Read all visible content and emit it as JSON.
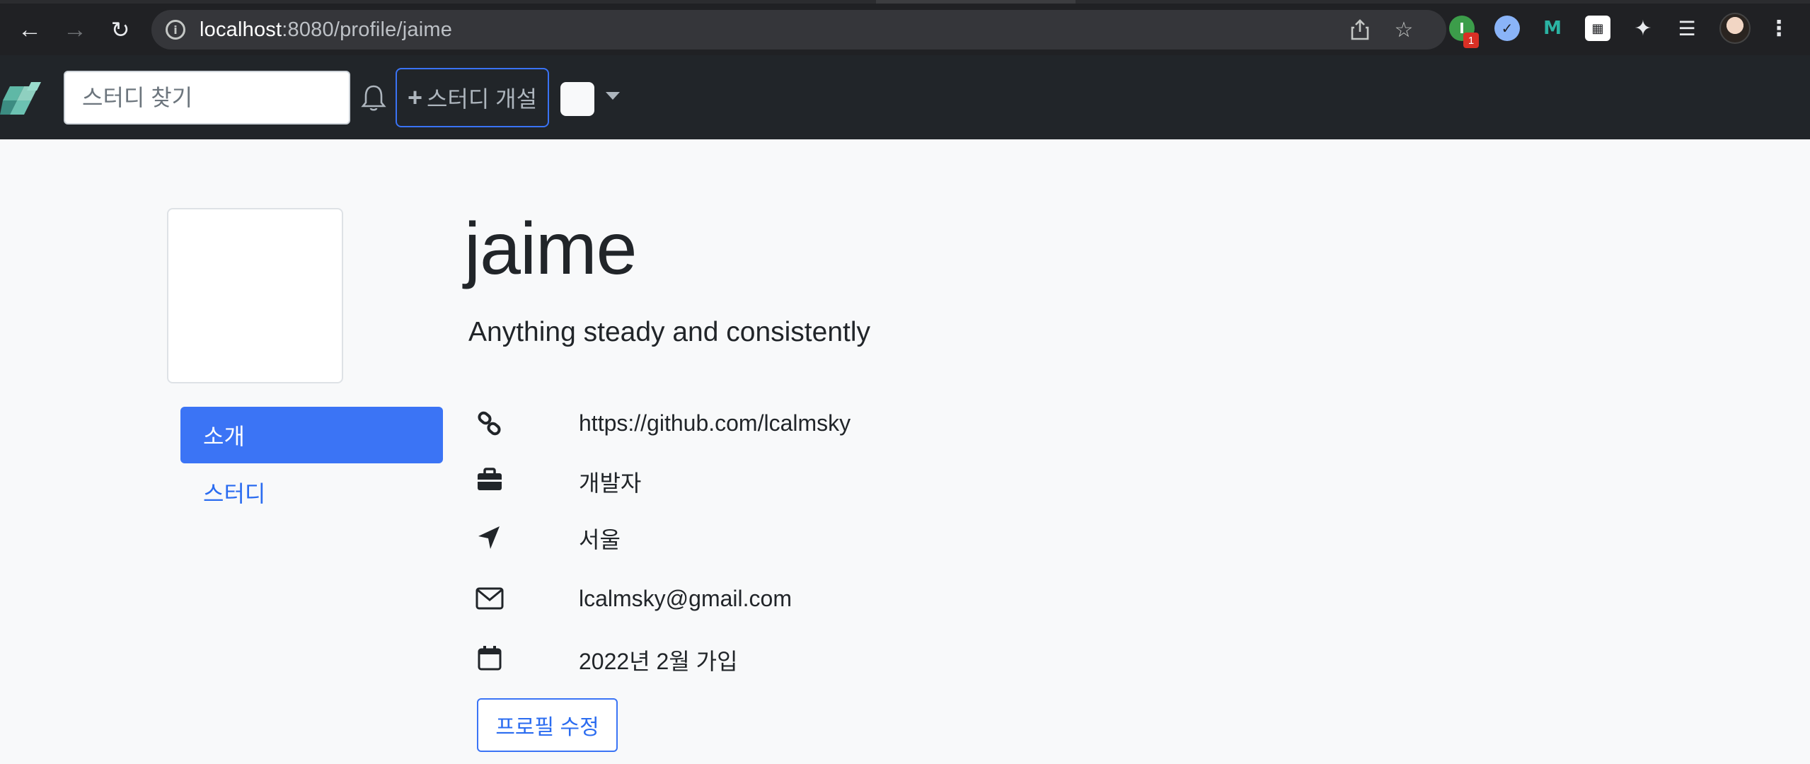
{
  "browser": {
    "url_host": "localhost",
    "url_path": ":8080/profile/jaime",
    "extension_badge": "1"
  },
  "navbar": {
    "search_placeholder": "스터디 찾기",
    "create_study_label": "스터디 개설"
  },
  "profile": {
    "name": "jaime",
    "bio": "Anything steady and consistently",
    "tabs": [
      {
        "label": "소개",
        "active": true
      },
      {
        "label": "스터디",
        "active": false
      }
    ],
    "details": {
      "url": "https://github.com/lcalmsky",
      "occupation": "개발자",
      "location": "서울",
      "email": "lcalmsky@gmail.com",
      "joined": "2022년 2월 가입"
    },
    "edit_button_label": "프로필 수정"
  },
  "colors": {
    "primary": "#3b74f5",
    "navbar": "#212529",
    "page_bg": "#f8f9fa"
  }
}
